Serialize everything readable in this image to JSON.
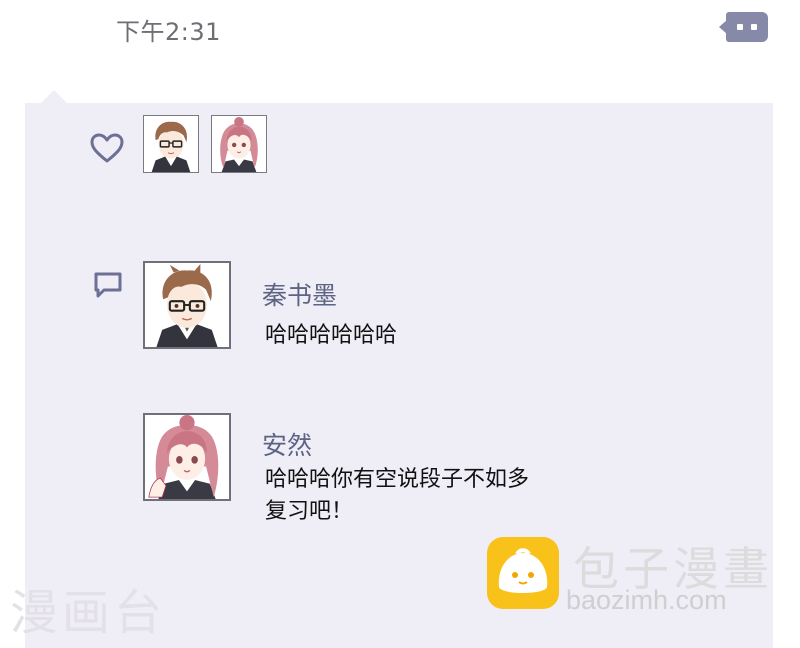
{
  "status": {
    "time": "下午2:31"
  },
  "toolbar": {
    "more_icon": "more-dots-icon"
  },
  "likes": {
    "icon": "heart-icon",
    "avatars": [
      "boy-avatar",
      "girl-avatar"
    ]
  },
  "comments": {
    "icon": "comment-icon",
    "items": [
      {
        "author": "秦书墨",
        "text": "哈哈哈哈哈哈",
        "avatar": "boy-avatar"
      },
      {
        "author": "安然",
        "text": "哈哈哈你有空说段子不如多\n复习吧！",
        "avatar": "girl-avatar"
      }
    ]
  },
  "watermarks": {
    "left": "漫画台",
    "brand": "包子漫畫",
    "url": "baozimh.com"
  },
  "colors": {
    "panel": "#efedf6",
    "accent": "#8689a8",
    "name": "#5d6383",
    "logo": "#f8c21a"
  }
}
